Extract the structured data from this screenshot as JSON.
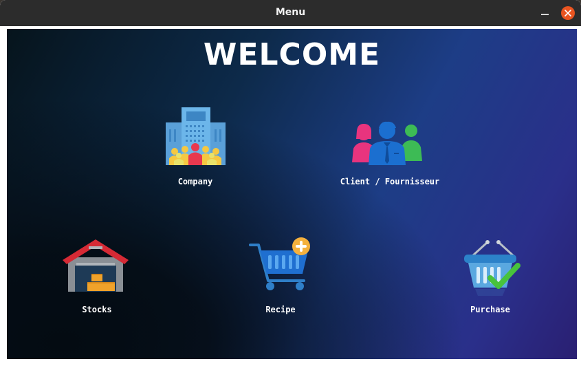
{
  "window": {
    "title": "Menu"
  },
  "main": {
    "heading": "WELCOME"
  },
  "menu": {
    "company": "Company",
    "client": "Client / Fournisseur",
    "stocks": "Stocks",
    "recipe": "Recipe",
    "purchase": "Purchase"
  },
  "colors": {
    "close_button": "#e95420",
    "titlebar": "#2c2c2c",
    "background_gradient": [
      "#06141c",
      "#1d3d86",
      "#2a1f72"
    ]
  },
  "icons": [
    "company-building-icon",
    "clients-people-icon",
    "warehouse-icon",
    "cart-add-icon",
    "basket-check-icon"
  ]
}
